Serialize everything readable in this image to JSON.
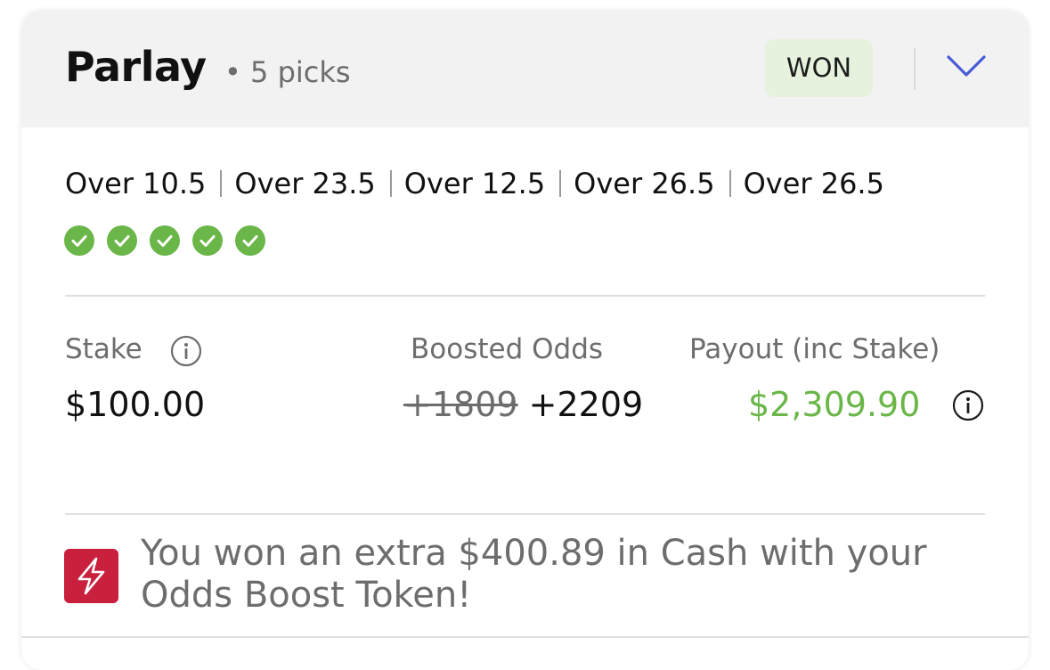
{
  "header": {
    "title": "Parlay",
    "subtitle": "• 5 picks",
    "status": "WON",
    "expand_icon": "chevron-down-icon"
  },
  "picks": [
    {
      "label": "Over 10.5",
      "result": "won"
    },
    {
      "label": "Over 23.5",
      "result": "won"
    },
    {
      "label": "Over 12.5",
      "result": "won"
    },
    {
      "label": "Over 26.5",
      "result": "won"
    },
    {
      "label": "Over 26.5",
      "result": "won"
    }
  ],
  "summary": {
    "stake_label": "Stake",
    "stake_value": "$100.00",
    "odds_label": "Boosted Odds",
    "odds_original": "+1809",
    "odds_boosted": "+2209",
    "payout_label": "Payout (inc Stake)",
    "payout_value": "$2,309.90"
  },
  "boost_message": "You won an extra $400.89 in Cash with your Odds Boost Token!",
  "colors": {
    "won_badge_bg": "#e6f2de",
    "check_green": "#6ab648",
    "payout_green": "#6ab648",
    "chevron_blue": "#4a5bd6",
    "boost_red": "#c8203d",
    "header_bg": "#f2f2f2"
  },
  "icons": {
    "check": "check-circle-icon",
    "info": "info-icon",
    "boost": "lightning-bolt-icon"
  }
}
